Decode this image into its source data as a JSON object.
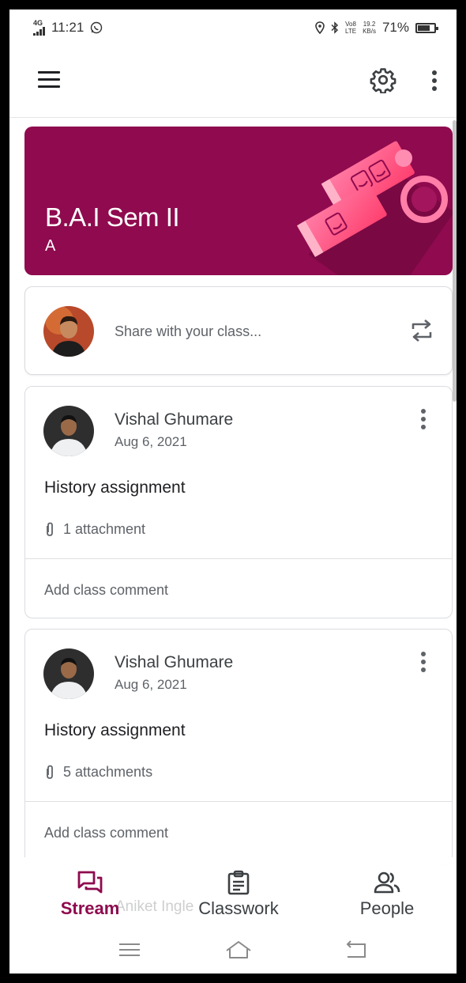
{
  "status_bar": {
    "network": "4G",
    "time": "11:21",
    "volte": "Vo8",
    "lte": "LTE",
    "speed_value": "19.2",
    "speed_unit": "KB/s",
    "battery": "71%"
  },
  "app_bar": {
    "menu_icon": "menu-icon",
    "settings_icon": "gear-icon",
    "more_icon": "more-vert-icon"
  },
  "class_banner": {
    "title": "B.A.I Sem II",
    "section": "A",
    "color": "#8f0a4e"
  },
  "share": {
    "placeholder": "Share with your class..."
  },
  "posts": [
    {
      "author": "Vishal Ghumare",
      "date": "Aug 6, 2021",
      "title": "History assignment",
      "attachments": "1 attachment",
      "comment_placeholder": "Add class comment"
    },
    {
      "author": "Vishal Ghumare",
      "date": "Aug 6, 2021",
      "title": "History assignment",
      "attachments": "5 attachments",
      "comment_placeholder": "Add class comment"
    }
  ],
  "bottom_nav": {
    "items": [
      {
        "label": "Stream",
        "icon": "stream-icon",
        "active": true
      },
      {
        "label": "Classwork",
        "icon": "classwork-icon",
        "active": false
      },
      {
        "label": "People",
        "icon": "people-icon",
        "active": false
      }
    ],
    "accent": "#8f0a4e"
  },
  "ghost_post": {
    "author": "Aniket Ingle"
  }
}
